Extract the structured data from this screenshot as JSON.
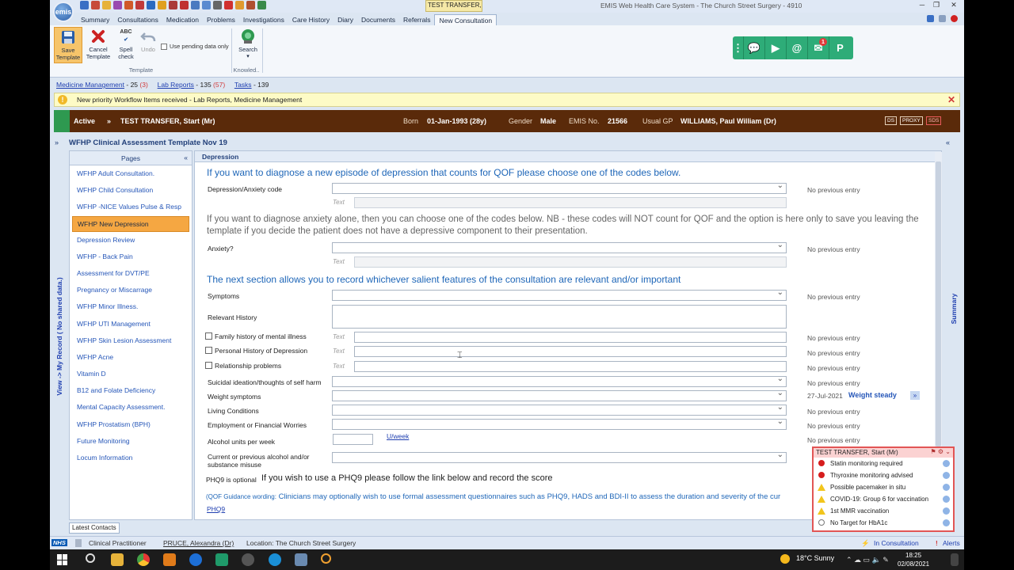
{
  "titlebar": {
    "patient_tab": "TEST TRANSFER, St...",
    "app_title": "EMIS Web Health Care System - The Church Street Surgery - 4910",
    "logo": "emis"
  },
  "menu": {
    "tabs": [
      "Summary",
      "Consultations",
      "Medication",
      "Problems",
      "Investigations",
      "Care History",
      "Diary",
      "Documents",
      "Referrals",
      "New Consultation"
    ],
    "active_index": 9
  },
  "ribbon": {
    "save": "Save Template",
    "cancel": "Cancel Template",
    "spell": "Spell check",
    "undo": "Undo",
    "pending": "Use pending data only",
    "group_template": "Template",
    "search": "Search",
    "group_knowledge": "Knowled..",
    "spell_abc": "ABC"
  },
  "comm": {
    "dots": "⋮",
    "chat": "💬",
    "video": "▶",
    "at": "@",
    "inbox": "✉",
    "badge": "1",
    "p": "P"
  },
  "links": {
    "medicine": "Medicine Management",
    "medicine_count": "- 25",
    "medicine_red": "(3)",
    "lab": "Lab Reports",
    "lab_count": "- 135",
    "lab_red": "(57)",
    "tasks": "Tasks",
    "tasks_count": "- 139"
  },
  "notification": {
    "text": "New priority Workflow Items received - Lab Reports, Medicine Management"
  },
  "patient": {
    "status": "Active",
    "name": "TEST TRANSFER, Start (Mr)",
    "born_label": "Born",
    "born": "01-Jan-1993 (28y)",
    "gender_label": "Gender",
    "gender": "Male",
    "emis_label": "EMIS No.",
    "emis_no": "21566",
    "gp_label": "Usual GP",
    "gp": "WILLIAMS, Paul William (Dr)",
    "tags": [
      "DS",
      "PROXY",
      "SDS"
    ]
  },
  "template": {
    "title": "WFHP Clinical Assessment Template Nov 19",
    "view_record": "View -> My Record ( No shared data.)",
    "summary": "Summary"
  },
  "pages": {
    "header": "Pages",
    "items": [
      "WFHP Adult Consultation.",
      "WFHP Child Consultation",
      "WFHP -NICE Values Pulse & Resp",
      "WFHP New Depression",
      "Depression Review",
      "WFHP - Back Pain",
      "Assessment for DVT/PE",
      "Pregnancy or Miscarrage",
      "WFHP Minor Illness.",
      "WFHP UTI Management",
      "WFHP Skin Lesion Assessment",
      "WFHP Acne",
      "Vitamin D",
      "B12 and Folate Deficiency",
      "Mental Capacity Assessment.",
      "WFHP Prostatism (BPH)",
      "Future Monitoring",
      "Locum Information"
    ],
    "active_index": 3
  },
  "form": {
    "section": "Depression",
    "heading1": "If you want to diagnose a new episode of depression that counts for QOF please choose one of the codes below.",
    "depression_label": "Depression/Anxiety code",
    "text_label": "Text",
    "no_prev": "No previous entry",
    "heading2": "If you want to diagnose anxiety alone, then you can choose one of the codes below. NB - these codes will NOT count for QOF and the option is here only to save you leaving the template if you decide the patient does not have a depressive component to their presentation.",
    "anxiety_label": "Anxiety?",
    "heading3": "The next section allows you to record whichever salient features of the consultation are relevant and/or important",
    "symptoms": "Symptoms",
    "relevant": "Relevant History",
    "family": "Family history of mental illness",
    "personal": "Personal History of Depression",
    "relationship": "Relationship problems",
    "suicidal": "Suicidal ideation/thoughts of self harm",
    "weight": "Weight symptoms",
    "weight_date": "27-Jul-2021",
    "weight_value": "Weight steady",
    "living": "Living Conditions",
    "employment": "Employment or Financial Worries",
    "alcohol": "Alcohol units per week",
    "uweek": "U/week",
    "current_alcohol_1": "Current or previous alcohol and/or",
    "current_alcohol_2": "substance misuse",
    "phq_small": "PHQ9 is optional",
    "phq_big": "If you wish to use a PHQ9 please follow the link below and record the score",
    "qof_small": "(QOF Guidance wording:",
    "qof_text": "Clinicians may optionally wish to use formal assessment questionnaires such as PHQ9, HADS and BDI-II to assess the duration and severity of the cur",
    "phq9_link": "PHQ9"
  },
  "alerts": {
    "patient": "TEST TRANSFER, Start (Mr)",
    "items": [
      {
        "text": "Statin monitoring required",
        "kind": "dot"
      },
      {
        "text": "Thyroxine monitoring advised",
        "kind": "dot"
      },
      {
        "text": "Possible pacemaker in situ",
        "kind": "tri"
      },
      {
        "text": "COVID-19: Group 6 for vaccination",
        "kind": "tri"
      },
      {
        "text": "1st MMR vaccination",
        "kind": "tri"
      },
      {
        "text": "No Target for HbA1c",
        "kind": "circ"
      }
    ]
  },
  "bottom": {
    "latest": "Latest Contacts",
    "nhs": "NHS",
    "role": "Clinical Practitioner",
    "user": "PRUCE, Alexandra (Dr)",
    "location": "Location:  The Church Street Surgery",
    "in_consult": "In Consultation",
    "alerts": "Alerts"
  },
  "taskbar": {
    "weather": "18°C  Sunny",
    "time": "18:25",
    "date": "02/08/2021"
  },
  "colors": {
    "banner": "#5a2a0a",
    "comm": "#2eac78",
    "accent": "#f5a742",
    "link": "#1f3fb0"
  }
}
